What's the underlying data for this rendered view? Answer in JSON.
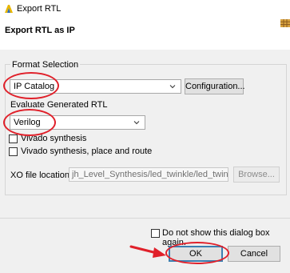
{
  "window": {
    "title": "Export RTL"
  },
  "header": {
    "title": "Export RTL as IP"
  },
  "format": {
    "group_label": "Format Selection",
    "selected": "IP Catalog",
    "configure_button": "Configuration..."
  },
  "evaluate": {
    "label": "Evaluate Generated RTL",
    "selected": "Verilog",
    "checkbox1_label": "Vivado synthesis",
    "checkbox2_label": "Vivado synthesis, place and route"
  },
  "xo": {
    "label": "XO file location:",
    "value": "jh_Level_Synthesis/led_twinkle/led_twinkle.xo",
    "browse_button": "Browse..."
  },
  "footer": {
    "dont_show_label": "Do not show this dialog box again.",
    "ok_button": "OK",
    "cancel_button": "Cancel"
  },
  "colors": {
    "annotation_red": "#e0202a",
    "app_icon_yellow": "#e8b600"
  },
  "icons": [
    "vivado-hls-app-icon",
    "grid-icon",
    "chevron-down-icon",
    "red-arrow-icon"
  ]
}
